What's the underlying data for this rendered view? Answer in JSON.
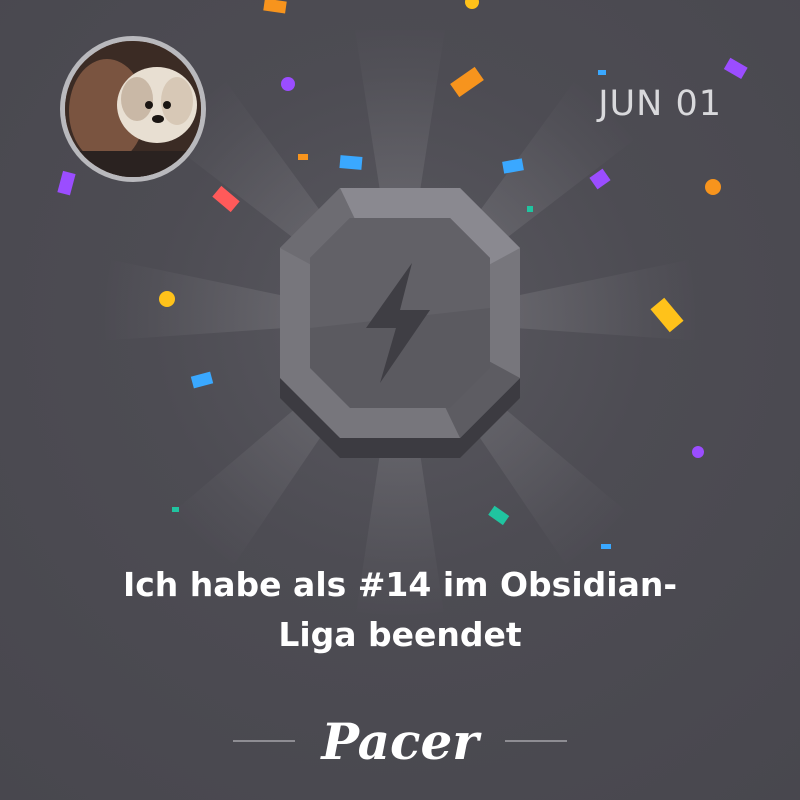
{
  "header": {
    "date": "JUN 01"
  },
  "avatar": {
    "description": "user-profile-photo"
  },
  "badge": {
    "icon": "lightning-bolt-icon",
    "league": "Obsidian",
    "rank": "#14"
  },
  "message": {
    "line1": "Ich habe als #14 im Obsidian-",
    "line2": "Liga beendet"
  },
  "brand": {
    "name": "Pacer"
  },
  "colors": {
    "background": "#4a4950",
    "badge": "#6f6e75",
    "text": "#ffffff",
    "date": "#d9d9dc",
    "confetti": [
      "#f7941d",
      "#9b4dff",
      "#3aa8ff",
      "#ffc21a",
      "#ff5a5a",
      "#20c4a0"
    ]
  }
}
